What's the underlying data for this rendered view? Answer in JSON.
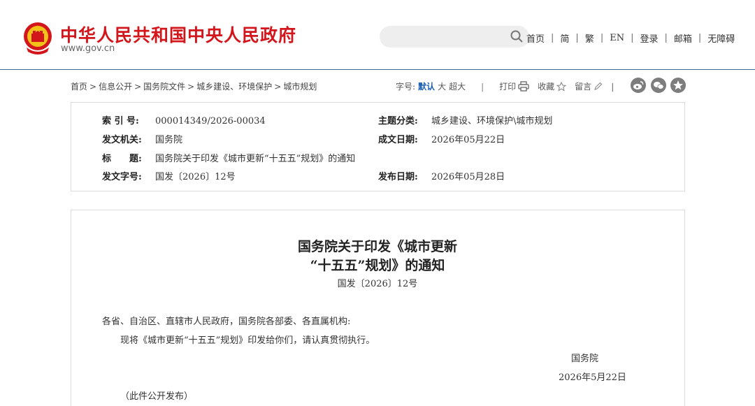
{
  "header": {
    "site_title": "中华人民共和国中央人民政府",
    "site_url": "www.gov.cn",
    "search_placeholder": "",
    "nav": [
      "首页",
      "简",
      "繁",
      "EN",
      "登录",
      "邮箱",
      "无障碍"
    ]
  },
  "breadcrumb": [
    "首页",
    "信息公开",
    "国务院文件",
    "城乡建设、环境保护",
    "城市规划"
  ],
  "tools": {
    "font_label": "字号:",
    "font_default": "默认",
    "font_large": "大",
    "font_xlarge": "超大",
    "divider": "|",
    "print": "打印",
    "favorite": "收藏",
    "comment": "留言"
  },
  "share_icons": [
    "weibo-icon",
    "wechat-icon",
    "favorite-star-icon"
  ],
  "info": {
    "index_label": "索 引 号:",
    "index_value": "000014349/2026-00034",
    "topic_label": "主题分类:",
    "topic_value": "城乡建设、环境保护\\城市规划",
    "issuer_label": "发文机关:",
    "issuer_value": "国务院",
    "date_written_label": "成文日期:",
    "date_written_value": "2026年05月22日",
    "title_label": "标　　题:",
    "title_value": "国务院关于印发《城市更新“十五五”规划》的通知",
    "doc_no_label": "发文字号:",
    "doc_no_value": "国发〔2026〕12号",
    "publish_label": "发布日期:",
    "publish_value": "2026年05月28日"
  },
  "document": {
    "title_line1": "国务院关于印发《城市更新",
    "title_line2": "“十五五”规划》的通知",
    "doc_number": "国发〔2026〕12号",
    "salutation": "各省、自治区、直辖市人民政府，国务院各部委、各直属机构:",
    "body": "现将《城市更新“十五五”规划》印发给你们，请认真贯彻执行。",
    "signer": "国务院",
    "date": "2026年5月22日",
    "note": "（此件公开发布）"
  },
  "colors": {
    "brand_red": "#d3161c",
    "header_rule": "#3c6e9a",
    "active_blue": "#1a5fb4"
  }
}
